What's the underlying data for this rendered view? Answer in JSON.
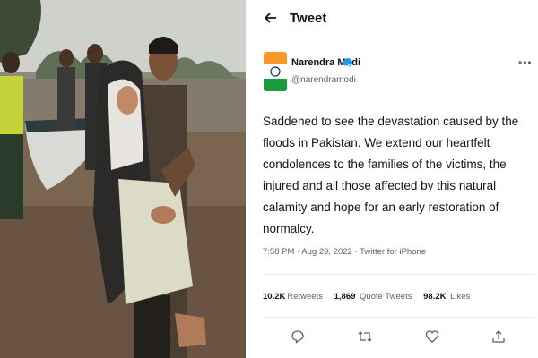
{
  "header": {
    "back_icon": "back-arrow-icon",
    "title": "Tweet"
  },
  "author": {
    "name": "Narendra Modi",
    "handle": "@narendramodi",
    "verified": true
  },
  "tweet": {
    "text": "Saddened to see the devastation caused by the floods in Pakistan. We extend our heartfelt condolences to the families of the victims, the injured and all those affected by this natural calamity and hope for an early restoration of normalcy.",
    "time": "7:58 PM",
    "date": "Aug 29, 2022",
    "source": "Twitter for iPhone"
  },
  "stats": {
    "retweets_count": "10.2K",
    "retweets_label": "Retweets",
    "quotes_count": "1,869",
    "quotes_label": "Quote Tweets",
    "likes_count": "98.2K",
    "likes_label": "Likes"
  },
  "actions": {
    "reply": "reply-icon",
    "retweet": "retweet-icon",
    "like": "like-icon",
    "share": "share-icon"
  },
  "colors": {
    "accent": "#1d9bf0",
    "text": "#0f1419",
    "muted": "#536471",
    "divider": "#e6ebef"
  }
}
